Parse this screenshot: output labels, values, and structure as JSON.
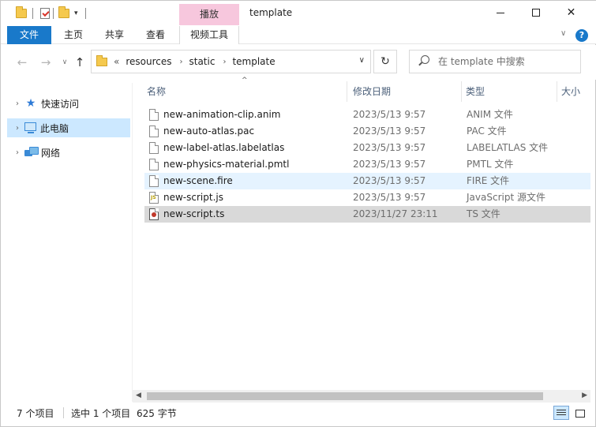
{
  "window": {
    "title": "template",
    "context_tab": "播放",
    "minimize": "—",
    "maximize": "☐",
    "close": "✕"
  },
  "ribbon": {
    "tabs": [
      "文件",
      "主页",
      "共享",
      "查看"
    ],
    "context_tool": "视频工具"
  },
  "address": {
    "crumbs": [
      "«",
      "resources",
      "static",
      "template"
    ],
    "search_placeholder": "在 template 中搜索"
  },
  "navpane": {
    "items": [
      {
        "label": "快速访问",
        "icon": "star-icon"
      },
      {
        "label": "此电脑",
        "icon": "computer-icon",
        "selected": true
      },
      {
        "label": "网络",
        "icon": "network-icon"
      }
    ]
  },
  "columns": {
    "name": "名称",
    "date": "修改日期",
    "type": "类型",
    "size": "大小"
  },
  "files": [
    {
      "name": "new-animation-clip.anim",
      "date": "2023/5/13 9:57",
      "type": "ANIM 文件",
      "icon": "file-icon"
    },
    {
      "name": "new-auto-atlas.pac",
      "date": "2023/5/13 9:57",
      "type": "PAC 文件",
      "icon": "file-icon"
    },
    {
      "name": "new-label-atlas.labelatlas",
      "date": "2023/5/13 9:57",
      "type": "LABELATLAS 文件",
      "icon": "file-icon"
    },
    {
      "name": "new-physics-material.pmtl",
      "date": "2023/5/13 9:57",
      "type": "PMTL 文件",
      "icon": "file-icon"
    },
    {
      "name": "new-scene.fire",
      "date": "2023/5/13 9:57",
      "type": "FIRE 文件",
      "icon": "file-icon",
      "state": "hover"
    },
    {
      "name": "new-script.js",
      "date": "2023/5/13 9:57",
      "type": "JavaScript 源文件",
      "icon": "js-file-icon"
    },
    {
      "name": "new-script.ts",
      "date": "2023/11/27 23:11",
      "type": "TS 文件",
      "icon": "ts-file-icon",
      "state": "selected"
    }
  ],
  "status": {
    "count": "7 个项目",
    "selection": "选中 1 个项目",
    "size": "625 字节"
  },
  "colors": {
    "accent": "#1979ca",
    "context_tab": "#f7c7dd",
    "selection": "#cce8ff"
  }
}
